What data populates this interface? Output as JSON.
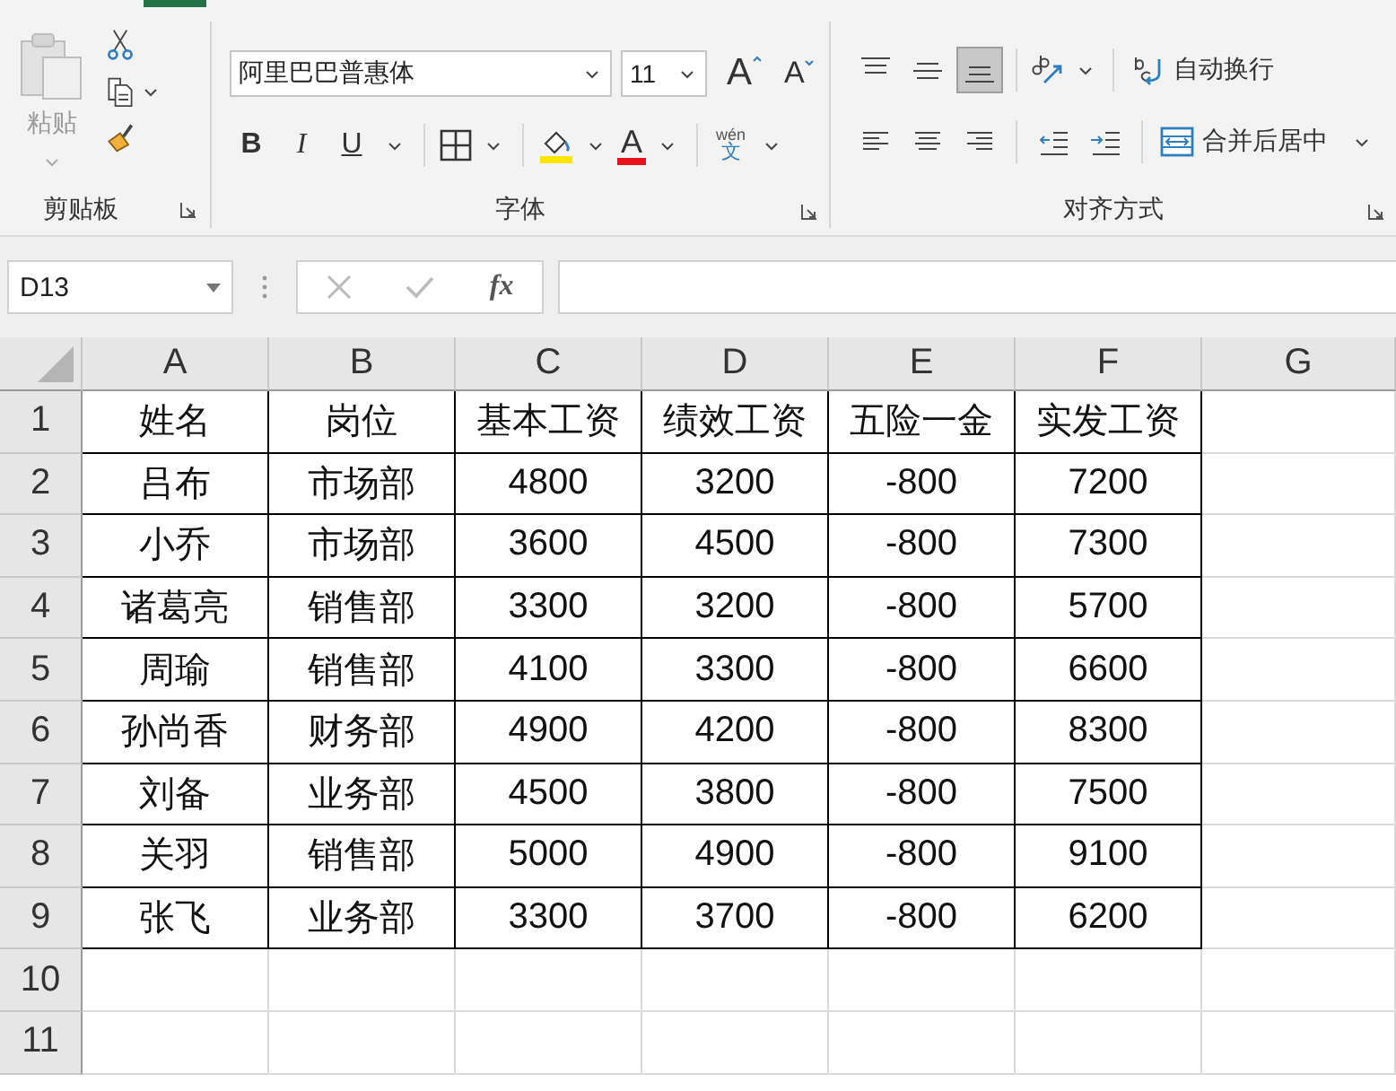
{
  "ribbon": {
    "clipboard": {
      "paste_label": "粘贴",
      "label": "剪贴板"
    },
    "font": {
      "font_name": "阿里巴巴普惠体",
      "font_size": "11",
      "grow_glyph": "A",
      "shrink_glyph": "A",
      "style_buttons": [
        "B",
        "I",
        "U"
      ],
      "font_color_glyph": "A",
      "phonetic_top": "wén",
      "phonetic_bottom": "文",
      "label": "字体"
    },
    "alignment": {
      "vertical_align": [
        {
          "kind": "top",
          "selected": false
        },
        {
          "kind": "middle",
          "selected": false
        },
        {
          "kind": "bottom",
          "selected": true
        }
      ],
      "wrap_text": "自动换行",
      "merge_center": "合并后居中",
      "label": "对齐方式"
    }
  },
  "formula_bar": {
    "name_box": "D13",
    "fx": "fx"
  },
  "sheet": {
    "columns": [
      "A",
      "B",
      "C",
      "D",
      "E",
      "F",
      "G"
    ],
    "rows": [
      {
        "number": "1",
        "cells": [
          "姓名",
          "岗位",
          "基本工资",
          "绩效工资",
          "五险一金",
          "实发工资"
        ]
      },
      {
        "number": "2",
        "cells": [
          "吕布",
          "市场部",
          "4800",
          "3200",
          "-800",
          "7200"
        ]
      },
      {
        "number": "3",
        "cells": [
          "小乔",
          "市场部",
          "3600",
          "4500",
          "-800",
          "7300"
        ]
      },
      {
        "number": "4",
        "cells": [
          "诸葛亮",
          "销售部",
          "3300",
          "3200",
          "-800",
          "5700"
        ]
      },
      {
        "number": "5",
        "cells": [
          "周瑜",
          "销售部",
          "4100",
          "3300",
          "-800",
          "6600"
        ]
      },
      {
        "number": "6",
        "cells": [
          "孙尚香",
          "财务部",
          "4900",
          "4200",
          "-800",
          "8300"
        ]
      },
      {
        "number": "7",
        "cells": [
          "刘备",
          "业务部",
          "4500",
          "3800",
          "-800",
          "7500"
        ]
      },
      {
        "number": "8",
        "cells": [
          "关羽",
          "销售部",
          "5000",
          "4900",
          "-800",
          "9100"
        ]
      },
      {
        "number": "9",
        "cells": [
          "张飞",
          "业务部",
          "3300",
          "3700",
          "-800",
          "6200"
        ]
      },
      {
        "number": "10"
      },
      {
        "number": "11"
      }
    ]
  }
}
